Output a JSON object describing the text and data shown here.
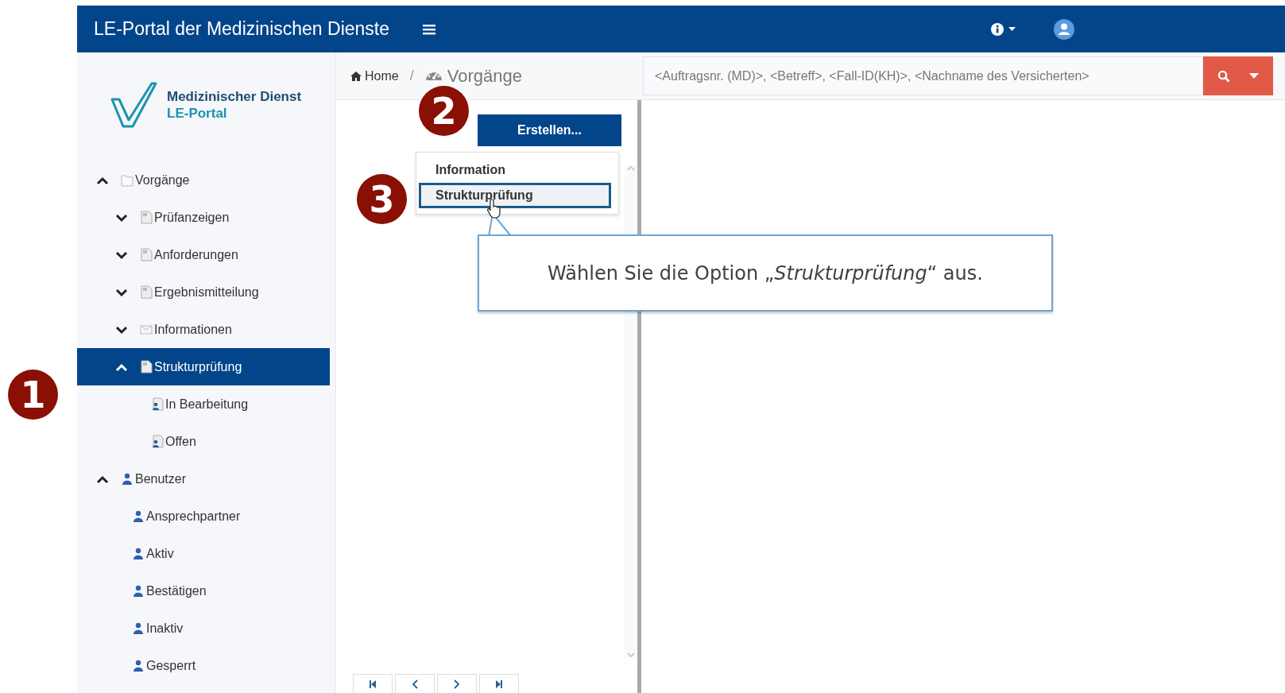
{
  "header": {
    "title": "LE-Portal der Medizinischen Dienste"
  },
  "logo": {
    "line1": "Medizinischer Dienst",
    "line2": "LE-Portal"
  },
  "tree": [
    {
      "label": "Vorgänge",
      "kind": "folder",
      "expanded": true,
      "selected": false,
      "children": [
        {
          "label": "Prüfanzeigen",
          "kind": "document",
          "expanded": false,
          "selected": false
        },
        {
          "label": "Anforderungen",
          "kind": "document",
          "expanded": false,
          "selected": false
        },
        {
          "label": "Ergebnismitteilung",
          "kind": "document",
          "expanded": false,
          "selected": false
        },
        {
          "label": "Informationen",
          "kind": "envelope",
          "expanded": false,
          "selected": false
        },
        {
          "label": "Strukturprüfung",
          "kind": "document",
          "expanded": true,
          "selected": true,
          "children": [
            {
              "label": "In Bearbeitung",
              "kind": "user-document",
              "selected": false
            },
            {
              "label": "Offen",
              "kind": "user-document",
              "selected": false
            }
          ]
        }
      ]
    },
    {
      "label": "Benutzer",
      "kind": "user",
      "expanded": true,
      "selected": false,
      "children": [
        {
          "label": "Ansprechpartner",
          "kind": "user",
          "selected": false
        },
        {
          "label": "Aktiv",
          "kind": "user",
          "selected": false
        },
        {
          "label": "Bestätigen",
          "kind": "user",
          "selected": false
        },
        {
          "label": "Inaktiv",
          "kind": "user",
          "selected": false
        },
        {
          "label": "Gesperrt",
          "kind": "user",
          "selected": false
        }
      ]
    }
  ],
  "breadcrumb": [
    {
      "label": "Home",
      "kind": "home"
    },
    {
      "label": "Vorgänge",
      "kind": "dashboard"
    }
  ],
  "breadcrumb_separator": "/",
  "create_button": {
    "label": "Erstellen..."
  },
  "dropdown": [
    {
      "label": "Information",
      "selected": false
    },
    {
      "label": "Strukturprüfung",
      "selected": true
    }
  ],
  "search": {
    "placeholder": "<Auftragsnr. (MD)>, <Betreff>, <Fall-ID(KH)>, <Nachname des Versicherten>"
  },
  "callout": {
    "text": "Wählen Sie die Option „*Strukturprüfung*“ aus."
  },
  "step_badges": [
    {
      "number": "1"
    },
    {
      "number": "2"
    },
    {
      "number": "3"
    }
  ]
}
